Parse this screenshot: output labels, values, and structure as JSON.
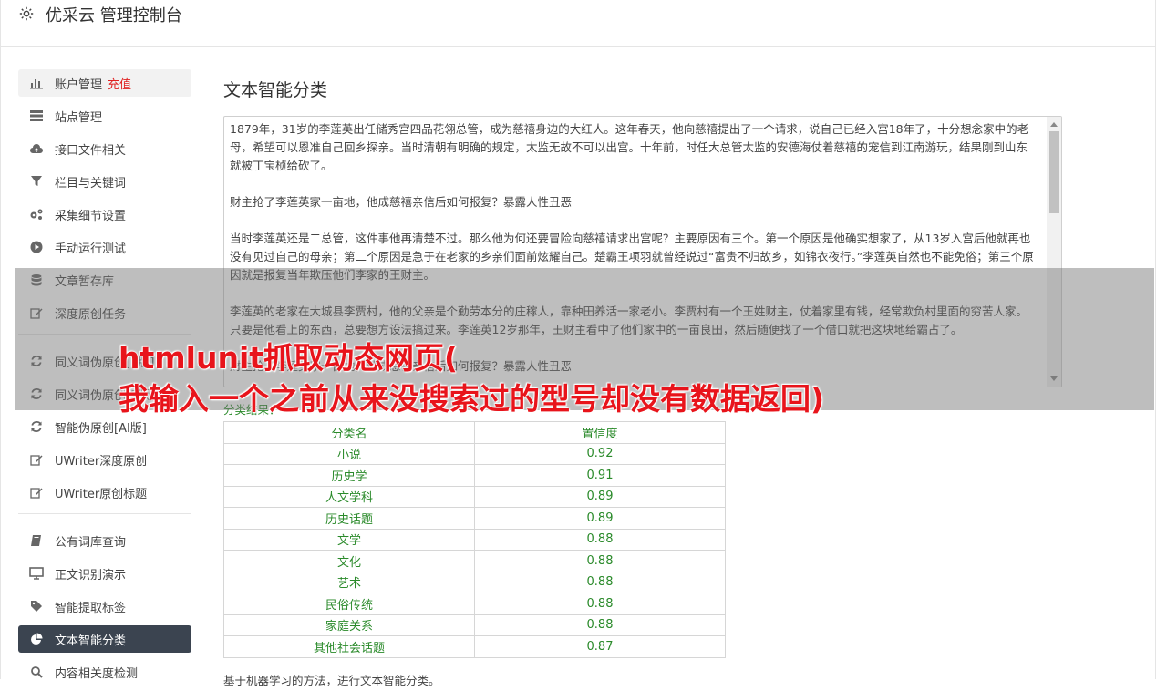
{
  "app": {
    "title": "优采云 管理控制台",
    "icon": "gear-icon"
  },
  "sidebar": {
    "group1": [
      {
        "label": "账户管理",
        "badge": "充值",
        "icon": "bar-chart-icon"
      },
      {
        "label": "站点管理",
        "icon": "server-icon"
      },
      {
        "label": "接口文件相关",
        "icon": "cloud-upload-icon"
      },
      {
        "label": "栏目与关键词",
        "icon": "filter-icon"
      },
      {
        "label": "采集细节设置",
        "icon": "gears-icon"
      },
      {
        "label": "手动运行测试",
        "icon": "play-circle-icon"
      },
      {
        "label": "文章暂存库",
        "icon": "database-icon"
      },
      {
        "label": "深度原创任务",
        "icon": "edit-icon"
      }
    ],
    "group2": [
      {
        "label": "同义词伪原创[1版]",
        "icon": "refresh-icon"
      },
      {
        "label": "同义词伪原创[2版]",
        "icon": "refresh-icon"
      },
      {
        "label": "智能伪原创[AI版]",
        "icon": "refresh-icon"
      },
      {
        "label": "UWriter深度原创",
        "icon": "edit-icon"
      },
      {
        "label": "UWriter原创标题",
        "icon": "edit-icon"
      }
    ],
    "group3": [
      {
        "label": "公有词库查询",
        "icon": "book-icon"
      },
      {
        "label": "正文识别演示",
        "icon": "monitor-icon"
      },
      {
        "label": "智能提取标签",
        "icon": "tag-icon"
      },
      {
        "label": "文本智能分类",
        "icon": "pie-chart-icon",
        "active": true
      },
      {
        "label": "内容相关度检测",
        "icon": "search-icon"
      }
    ]
  },
  "main": {
    "title": "文本智能分类",
    "text_paragraphs": [
      "1879年，31岁的李莲英出任储秀宫四品花翎总管，成为慈禧身边的大红人。这年春天，他向慈禧提出了一个请求，说自己已经入宫18年了，十分想念家中的老母，希望可以恩准自己回乡探亲。当时清朝有明确的规定，太监无故不可以出宫。十年前，时任大总管太监的安德海仗着慈禧的宠信到江南游玩，结果刚到山东就被丁宝桢给砍了。",
      "财主抢了李莲英家一亩地，他成慈禧亲信后如何报复？暴露人性丑恶",
      "当时李莲英还是二总管，这件事他再清楚不过。那么他为何还要冒险向慈禧请求出宫呢？主要原因有三个。第一个原因是他确实想家了，从13岁入宫后他就再也没有见过自己的母亲；第二个原因是急于在老家的乡亲们面前炫耀自己。楚霸王项羽就曾经说过“富贵不归故乡，如锦衣夜行。”李莲英自然也不能免俗；第三个原因就是报复当年欺压他们李家的王财主。",
      "李莲英的老家在大城县李贾村，他的父亲是个勤劳本分的庄稼人，靠种田养活一家老小。李贾村有一个王姓财主，仗着家里有钱，经常欺负村里面的穷苦人家。只要是他看上的东西，总要想方设法搞过来。李莲英12岁那年，王财主看中了他们家中的一亩良田，然后随便找了一个借口就把这块地给霸占了。",
      "财主抢了李莲英家一亩地，他成慈禧亲信后如何报复？暴露人性丑恶"
    ],
    "result_label": "分类结果：",
    "table": {
      "headers": [
        "分类名",
        "置信度"
      ],
      "rows": [
        [
          "小说",
          "0.92"
        ],
        [
          "历史学",
          "0.91"
        ],
        [
          "人文学科",
          "0.89"
        ],
        [
          "历史话题",
          "0.89"
        ],
        [
          "文学",
          "0.88"
        ],
        [
          "文化",
          "0.88"
        ],
        [
          "艺术",
          "0.88"
        ],
        [
          "民俗传统",
          "0.88"
        ],
        [
          "家庭关系",
          "0.88"
        ],
        [
          "其他社会话题",
          "0.87"
        ]
      ]
    },
    "footnote": "基于机器学习的方法，进行文本智能分类。"
  },
  "overlay": {
    "line1": "htmlunit抓取动态网页(",
    "line2": "我输入一个之前从来没搜索过的型号却没有数据返回)"
  },
  "colors": {
    "accent_red": "#e8141b",
    "active_nav": "#3b4450",
    "result_green": "#2a8a2a"
  }
}
